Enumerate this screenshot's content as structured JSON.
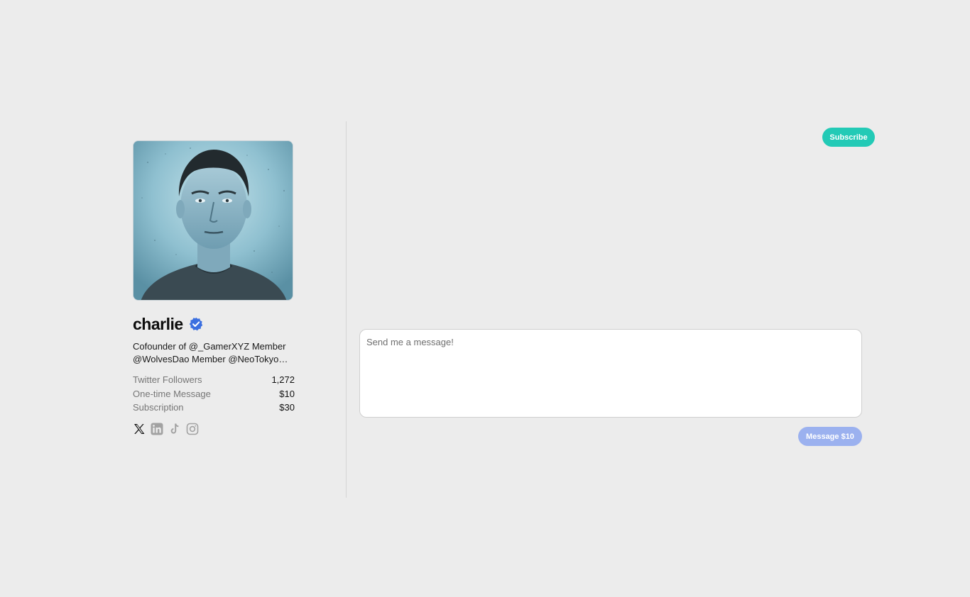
{
  "profile": {
    "name": "charlie",
    "bio_line1": "Cofounder of @_GamerXYZ Member",
    "bio_line2": "@WolvesDao Member @NeoTokyoCod...",
    "stats": [
      {
        "label": "Twitter Followers",
        "value": "1,272"
      },
      {
        "label": "One-time Message",
        "value": "$10"
      },
      {
        "label": "Subscription",
        "value": "$30"
      }
    ],
    "socials": [
      "x-icon",
      "linkedin-icon",
      "tiktok-icon",
      "instagram-icon"
    ]
  },
  "actions": {
    "subscribe_label": "Subscribe",
    "send_label": "Message $10"
  },
  "message": {
    "placeholder": "Send me a message!",
    "value": ""
  },
  "colors": {
    "background": "#ececec",
    "subscribe": "#23cab6",
    "send_disabled": "#9bb1ef",
    "verified": "#3b6fe0"
  }
}
